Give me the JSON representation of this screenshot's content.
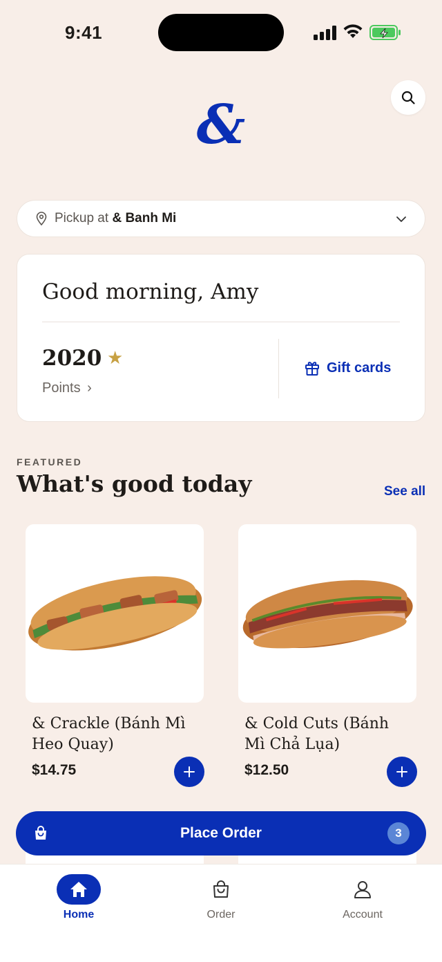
{
  "status": {
    "time": "9:41"
  },
  "header": {
    "logo": "&",
    "search_icon": "search-icon"
  },
  "pickup": {
    "prefix": "Pickup at",
    "location": "& Banh Mi"
  },
  "greeting": {
    "title": "Good morning, Amy",
    "points_value": "2020",
    "points_label": "Points",
    "gift_cards_label": "Gift cards"
  },
  "featured": {
    "eyebrow": "FEATURED",
    "title": "What's good today",
    "see_all": "See all",
    "products": [
      {
        "name": "& Crackle (Bánh Mì Heo Quay)",
        "price": "$14.75"
      },
      {
        "name": "& Cold Cuts (Bánh Mì Chả Lụa)",
        "price": "$12.50"
      }
    ]
  },
  "order_bar": {
    "label": "Place Order",
    "count": "3"
  },
  "nav": {
    "items": [
      {
        "label": "Home"
      },
      {
        "label": "Order"
      },
      {
        "label": "Account"
      }
    ]
  },
  "colors": {
    "accent": "#0A2FB5",
    "background": "#F8EEE8",
    "star": "#C7A144"
  }
}
